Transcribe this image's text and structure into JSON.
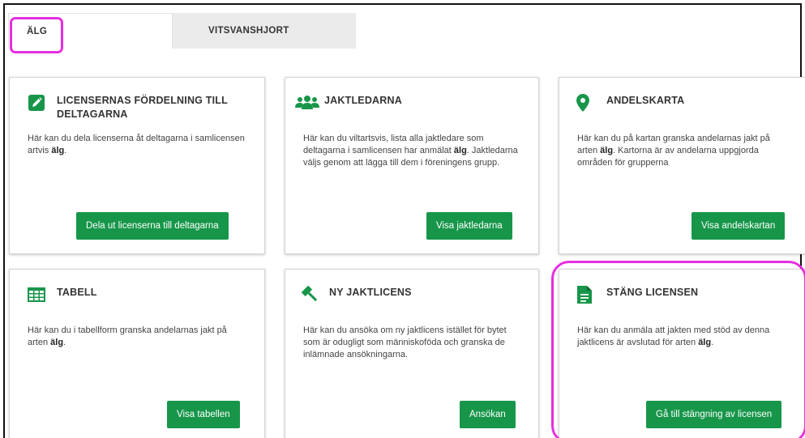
{
  "tabs": [
    {
      "label": "ÄLG"
    },
    {
      "label": "VITSVANSHJORT"
    }
  ],
  "colors": {
    "accent": "#17964a",
    "highlight": "#e62fe0"
  },
  "cards": [
    {
      "icon": "pencil-icon",
      "title": "LICENSERNAS FÖRDELNING TILL DELTAGARNA",
      "desc_pre": "Här kan du dela licenserna åt deltagarna i samlicensen artvis ",
      "desc_bold": "älg",
      "desc_post": ".",
      "button": "Dela ut licenserna till deltagarna"
    },
    {
      "icon": "group-icon",
      "title": "JAKTLEDARNA",
      "desc_pre": "Här kan du viltartsvis, lista alla jaktledare som deltagarna i samlicensen har anmälat ",
      "desc_bold": "älg",
      "desc_post": ". Jaktledarna väljs genom att lägga till dem i föreningens grupp.",
      "button": "Visa jaktledarna"
    },
    {
      "icon": "map-marker-icon",
      "title": "ANDELSKARTA",
      "desc_pre": "Här kan du på kartan granska andelarnas jakt på arten ",
      "desc_bold": "älg",
      "desc_post": ". Kartorna är av andelarna uppgjorda områden för grupperna",
      "button": "Visa andelskartan"
    },
    {
      "icon": "table-icon",
      "title": "TABELL",
      "desc_pre": "Här kan du i tabellform granska andelarnas jakt på arten ",
      "desc_bold": "älg",
      "desc_post": ".",
      "button": "Visa tabellen"
    },
    {
      "icon": "gavel-icon",
      "title": "NY JAKTLICENS",
      "desc_pre": "Här kan du ansöka om ny jaktlicens istället för bytet som är odugligt som människoföda och granska de inlämnade ansökningarna.",
      "desc_bold": "",
      "desc_post": "",
      "button": "Ansökan"
    },
    {
      "icon": "document-icon",
      "title": "STÄNG LICENSEN",
      "desc_pre": "Här kan du anmäla att jakten med stöd av denna jaktlicens är avslutad för arten ",
      "desc_bold": "älg",
      "desc_post": ".",
      "button": "Gå till stängning av licensen"
    }
  ]
}
